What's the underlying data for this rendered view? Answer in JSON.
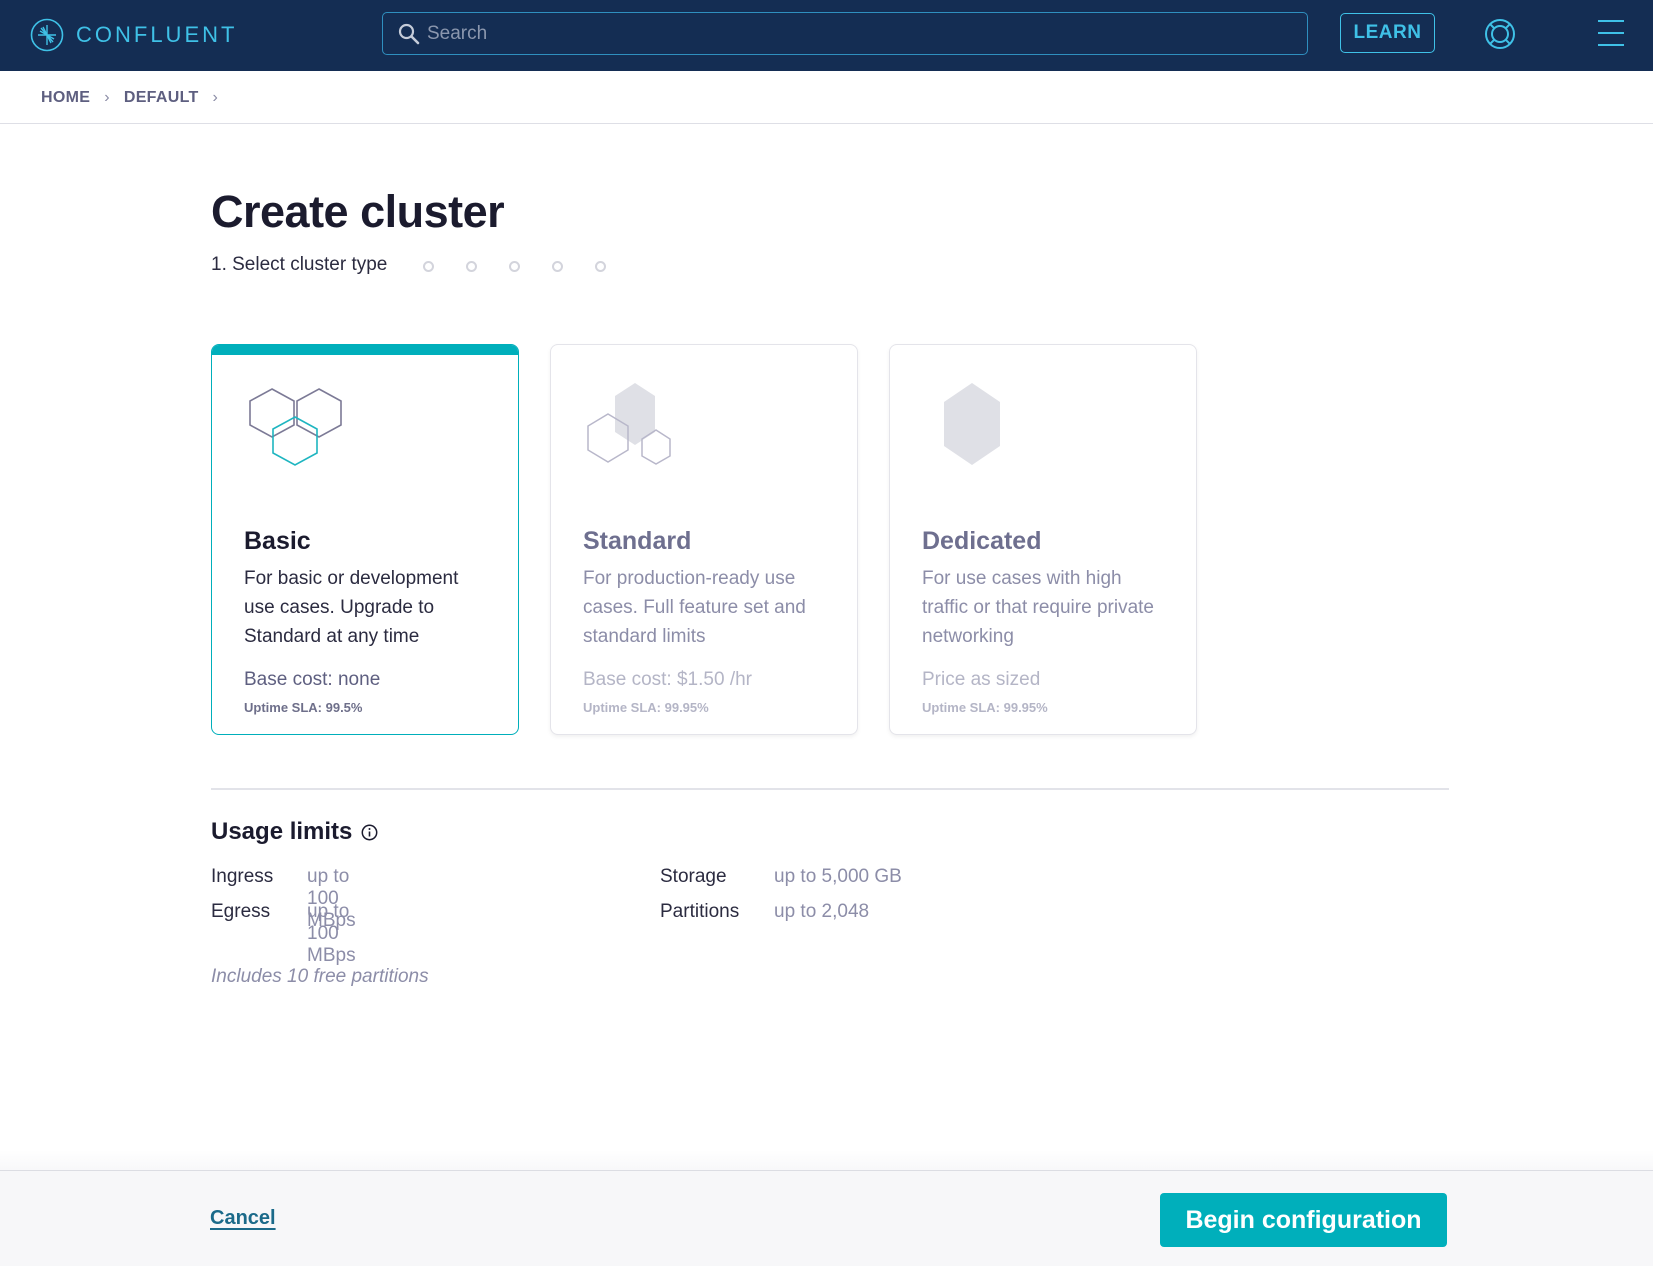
{
  "header": {
    "logo_text": "CONFLUENT",
    "search_placeholder": "Search",
    "search_value": "",
    "learn_label": "LEARN",
    "icons": {
      "logo": "confluent-logo-icon",
      "search": "search-icon",
      "help": "lifebuoy-icon",
      "menu": "hamburger-menu-icon"
    }
  },
  "breadcrumb": {
    "items": [
      "HOME",
      "DEFAULT"
    ],
    "separator": "›"
  },
  "page": {
    "title": "Create cluster",
    "step_label": "1. Select cluster type",
    "total_steps_remaining_dots": 5
  },
  "cards": [
    {
      "title": "Basic",
      "description": "For basic or development use cases. Upgrade to Standard at any time",
      "cost": "Base cost: none",
      "sla": "Uptime SLA: 99.5%",
      "selected": true
    },
    {
      "title": "Standard",
      "description": "For production-ready use cases. Full feature set and standard limits",
      "cost": "Base cost: $1.50 /hr",
      "sla": "Uptime SLA: 99.95%",
      "selected": false
    },
    {
      "title": "Dedicated",
      "description": "For use cases with high traffic or that require private networking",
      "cost": "Price as sized",
      "sla": "Uptime SLA: 99.95%",
      "selected": false
    }
  ],
  "usage": {
    "title": "Usage limits",
    "limits": [
      {
        "label": "Ingress",
        "value": "up to 100 MBps"
      },
      {
        "label": "Egress",
        "value": "up to 100 MBps"
      },
      {
        "label": "Storage",
        "value": "up to 5,000 GB"
      },
      {
        "label": "Partitions",
        "value": "up to 2,048"
      }
    ],
    "note": "Includes 10 free partitions"
  },
  "footer": {
    "cancel_label": "Cancel",
    "begin_label": "Begin configuration"
  },
  "colors": {
    "nav_bg": "#142d53",
    "accent_cyan": "#3fc1e7",
    "primary_teal": "#00afbb",
    "link": "#1b6a8a"
  }
}
